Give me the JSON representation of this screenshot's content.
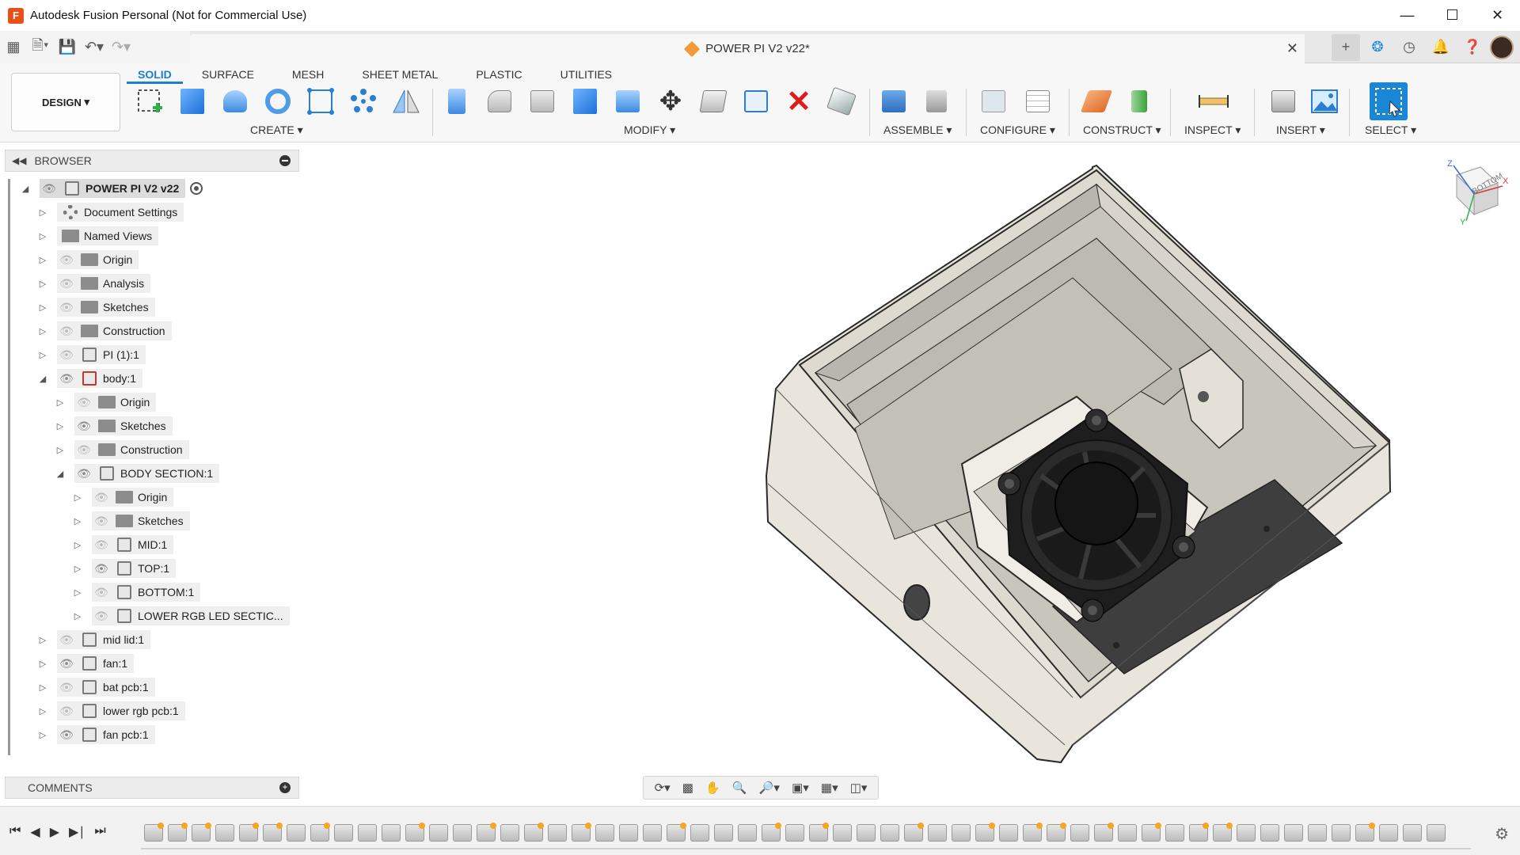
{
  "window": {
    "title": "Autodesk Fusion Personal (Not for Commercial Use)",
    "logo_letter": "F"
  },
  "document": {
    "tab_name": "POWER PI V2 v22*"
  },
  "ribbon": {
    "workspace": "DESIGN",
    "tabs": [
      {
        "label": "SOLID",
        "active": true
      },
      {
        "label": "SURFACE",
        "active": false
      },
      {
        "label": "MESH",
        "active": false
      },
      {
        "label": "SHEET METAL",
        "active": false
      },
      {
        "label": "PLASTIC",
        "active": false
      },
      {
        "label": "UTILITIES",
        "active": false
      }
    ],
    "groups": {
      "create": "CREATE",
      "modify": "MODIFY",
      "assemble": "ASSEMBLE",
      "configure": "CONFIGURE",
      "construct": "CONSTRUCT",
      "inspect": "INSPECT",
      "insert": "INSERT",
      "select": "SELECT"
    }
  },
  "browser": {
    "title": "BROWSER",
    "root": "POWER PI V2 v22",
    "items": [
      {
        "label": "Document Settings",
        "icon": "gear-icon"
      },
      {
        "label": "Named Views",
        "icon": "folder-icon"
      },
      {
        "label": "Origin",
        "icon": "folder-icon"
      },
      {
        "label": "Analysis",
        "icon": "folder-icon"
      },
      {
        "label": "Sketches",
        "icon": "folder-icon"
      },
      {
        "label": "Construction",
        "icon": "folder-icon"
      },
      {
        "label": "PI (1):1",
        "icon": "component-icon"
      },
      {
        "label": "body:1",
        "icon": "component-icon"
      },
      {
        "label": "Origin",
        "icon": "folder-icon"
      },
      {
        "label": "Sketches",
        "icon": "folder-icon"
      },
      {
        "label": "Construction",
        "icon": "folder-icon"
      },
      {
        "label": "BODY SECTION:1",
        "icon": "component-icon"
      },
      {
        "label": "Origin",
        "icon": "folder-icon"
      },
      {
        "label": "Sketches",
        "icon": "folder-icon"
      },
      {
        "label": "MID:1",
        "icon": "body-icon"
      },
      {
        "label": "TOP:1",
        "icon": "component-icon"
      },
      {
        "label": "BOTTOM:1",
        "icon": "body-icon"
      },
      {
        "label": "LOWER RGB LED SECTIC...",
        "icon": "body-icon"
      },
      {
        "label": "mid lid:1",
        "icon": "body-icon"
      },
      {
        "label": "fan:1",
        "icon": "body-icon"
      },
      {
        "label": "bat pcb:1",
        "icon": "body-icon"
      },
      {
        "label": "lower rgb pcb:1",
        "icon": "body-icon"
      },
      {
        "label": "fan pcb:1",
        "icon": "body-icon"
      }
    ]
  },
  "comments": {
    "title": "COMMENTS"
  },
  "viewcube": {
    "face": "BOTTOM",
    "axes": [
      "Z",
      "X",
      "Y"
    ]
  },
  "colors": {
    "accent": "#1a7fd0",
    "model_body": "#e9e5dc",
    "model_edge": "#2a2a2a"
  }
}
